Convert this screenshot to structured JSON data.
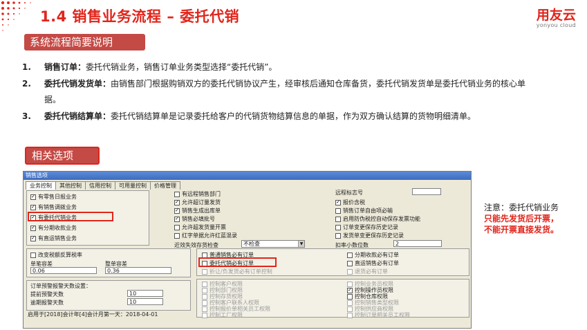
{
  "header": {
    "title": "1.4 销售业务流程 – 委托代销",
    "logo_cn": "用友云",
    "logo_en": "yonyou cloud"
  },
  "section1": {
    "label": "系统流程简要说明"
  },
  "items": [
    {
      "num": "1.",
      "term": "销售订单：",
      "text": "委托代销业务，销售订单业务类型选择“委托代销”。"
    },
    {
      "num": "2.",
      "term": "委托代销发货单：",
      "text": "由销售部门根据购销双方的委托代销协议产生，经审核后通知仓库备货，委托代销发货单是委托代销业务的核心单据。"
    },
    {
      "num": "3.",
      "term": "委托代销结算单：",
      "text": "委托代销结算单是记录委托给客户的代销货物结算信息的单据，作为双方确认结算的货物明细清单。"
    }
  ],
  "section2": {
    "label": "相关选项"
  },
  "dialog": {
    "title": "销售选项",
    "tabs": [
      "业务控制",
      "其他控制",
      "信用控制",
      "可用量控制",
      "价格管理"
    ],
    "left_checks": [
      {
        "label": "有零售日报业务",
        "checked": true
      },
      {
        "label": "有销售调拨业务",
        "checked": true
      },
      {
        "label": "有委托代销业务",
        "checked": true
      },
      {
        "label": "有分期收款业务",
        "checked": true
      },
      {
        "label": "有直运销售业务",
        "checked": true
      }
    ],
    "mid_checks": [
      {
        "label": "有远程销售部门",
        "checked": false
      },
      {
        "label": "允许超订量发货",
        "checked": true
      },
      {
        "label": "销售生成出库单",
        "checked": true
      },
      {
        "label": "销售必填批号",
        "checked": true
      },
      {
        "label": "允许超发货量开票",
        "checked": false
      },
      {
        "label": "红字单据允许红蓝混录",
        "checked": false
      }
    ],
    "right_checks": [
      {
        "label": "报价含税",
        "checked": true
      },
      {
        "label": "销售订单自由项必输",
        "checked": false
      },
      {
        "label": "启用防伪税控自动保存发票功能",
        "checked": false
      },
      {
        "label": "订单变更保存历史记录",
        "checked": false
      },
      {
        "label": "发货单变更保存历史记录",
        "checked": false
      }
    ],
    "remote_mark_label": "远程标志号",
    "remote_mark_value": "",
    "validity_label": "近效失效存货检查",
    "validity_value": "不检查",
    "decimal_label": "扣率小数位数",
    "decimal_value": "2",
    "tax_adjust_label": "改变税额反算税率",
    "single_diff_label": "单笔容差",
    "single_diff_value": "0.06",
    "total_diff_label": "整单容差",
    "total_diff_value": "0.36",
    "order_group": [
      {
        "label": "普通销售必有订单",
        "checked": false
      },
      {
        "label": "委托代销必有订单",
        "checked": false
      },
      {
        "label": "折让/负发货必有订单控制",
        "checked": false,
        "disabled": true
      }
    ],
    "order_group_right": [
      {
        "label": "分期收款必有订单",
        "checked": false
      },
      {
        "label": "直运销售必有订单",
        "checked": false
      },
      {
        "label": "退货必有订单",
        "checked": false,
        "disabled": true
      }
    ],
    "alert_title": "订单预警报警天数设置：",
    "alert_early_label": "提前预警天数",
    "alert_early_value": "10",
    "alert_late_label": "逾期报警天数",
    "alert_late_value": "10",
    "perm_left": [
      "控制客户权限",
      "控制部门权限",
      "控制存货权限",
      "控制客户联系人权限",
      "控制报价单相关员工权限",
      "控制工厂权限"
    ],
    "perm_right": [
      "控制业务员权限",
      "控制操作员权限",
      "控制仓库权限",
      "控制销售类型权限",
      "控制供应商权限",
      "控制订单相关员工权限"
    ],
    "footer": "启用于[2018]会计年[4]会计月第一天：2018-04-01"
  },
  "note": {
    "line1": "注意：委托代销业务",
    "line2": "只能先发货后开票，",
    "line3": "不能开票直接发货。"
  },
  "colors": {
    "accent": "#e1251b",
    "tag_bg": "#c44a45"
  }
}
